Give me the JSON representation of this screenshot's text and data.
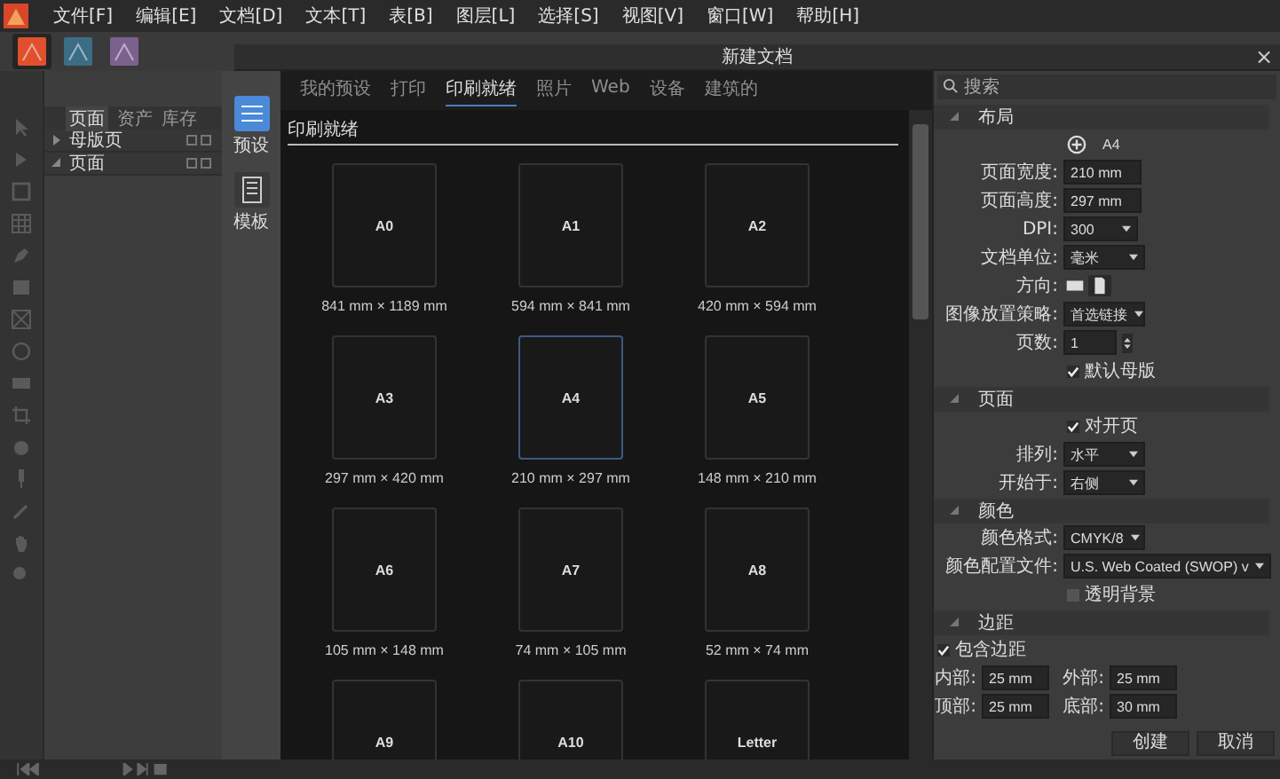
{
  "menu": [
    "文件[F]",
    "编辑[E]",
    "文档[D]",
    "文本[T]",
    "表[B]",
    "图层[L]",
    "选择[S]",
    "视图[V]",
    "窗口[W]",
    "帮助[H]"
  ],
  "apps": [
    {
      "kind": "publisher",
      "selected": true
    },
    {
      "kind": "designer",
      "selected": false
    },
    {
      "kind": "photo",
      "selected": false
    }
  ],
  "pages_panel": {
    "tabs": [
      {
        "label": "页面",
        "selected": true
      },
      {
        "label": "资产",
        "selected": false
      },
      {
        "label": "库存",
        "selected": false
      }
    ],
    "rows": [
      {
        "label": "母版页",
        "expanded": false
      },
      {
        "label": "页面",
        "expanded": true
      }
    ]
  },
  "dialog": {
    "title": "新建文档",
    "close": "×",
    "sidebar": [
      {
        "label": "预设",
        "kind": "presets",
        "selected": true
      },
      {
        "label": "模板",
        "kind": "templates",
        "selected": false
      }
    ],
    "tabs": [
      {
        "label": "我的预设",
        "selected": false
      },
      {
        "label": "打印",
        "selected": false
      },
      {
        "label": "印刷就绪",
        "selected": true
      },
      {
        "label": "照片",
        "selected": false
      },
      {
        "label": "Web",
        "selected": false
      },
      {
        "label": "设备",
        "selected": false
      },
      {
        "label": "建筑的",
        "selected": false
      }
    ],
    "section_title": "印刷就绪",
    "presets": [
      {
        "name": "A0",
        "size": "841 mm × 1189 mm",
        "selected": false
      },
      {
        "name": "A1",
        "size": "594 mm × 841 mm",
        "selected": false
      },
      {
        "name": "A2",
        "size": "420 mm × 594 mm",
        "selected": false
      },
      {
        "name": "A3",
        "size": "297 mm × 420 mm",
        "selected": false
      },
      {
        "name": "A4",
        "size": "210 mm × 297 mm",
        "selected": true
      },
      {
        "name": "A5",
        "size": "148 mm × 210 mm",
        "selected": false
      },
      {
        "name": "A6",
        "size": "105 mm × 148 mm",
        "selected": false
      },
      {
        "name": "A7",
        "size": "74 mm × 105 mm",
        "selected": false
      },
      {
        "name": "A8",
        "size": "52 mm × 74 mm",
        "selected": false
      },
      {
        "name": "A9",
        "selected": false
      },
      {
        "name": "A10",
        "selected": false
      },
      {
        "name": "Letter",
        "selected": false
      }
    ],
    "search": {
      "placeholder": "搜索"
    },
    "sections": [
      {
        "title": "布局",
        "expanded": true,
        "fields": [
          {
            "kind": "preset",
            "value": "A4"
          },
          {
            "kind": "text",
            "label": "页面宽度:",
            "value": "210 mm"
          },
          {
            "kind": "text",
            "label": "页面高度:",
            "value": "297 mm"
          },
          {
            "kind": "combo",
            "label": "DPI:",
            "value": "300"
          },
          {
            "kind": "select",
            "label": "文档单位:",
            "value": "毫米"
          },
          {
            "kind": "orientation",
            "label": "方向:",
            "portrait": true
          },
          {
            "kind": "select",
            "label": "图像放置策略:",
            "value": "首选链接"
          },
          {
            "kind": "spinner",
            "label": "页数:",
            "value": "1"
          },
          {
            "kind": "checkbox",
            "label": "默认母版",
            "checked": true
          }
        ]
      },
      {
        "title": "页面",
        "expanded": true,
        "fields": [
          {
            "kind": "checkbox",
            "label": "对开页",
            "checked": true
          },
          {
            "kind": "select",
            "label": "排列:",
            "value": "水平"
          },
          {
            "kind": "select",
            "label": "开始于:",
            "value": "右侧"
          }
        ]
      },
      {
        "title": "颜色",
        "expanded": true,
        "fields": [
          {
            "kind": "select",
            "label": "颜色格式:",
            "value": "CMYK/8"
          },
          {
            "kind": "wide-select",
            "label": "颜色配置文件:",
            "value": "U.S. Web Coated (SWOP) v"
          },
          {
            "kind": "checkbox",
            "label": "透明背景",
            "checked": false
          }
        ]
      },
      {
        "title": "边距",
        "expanded": true,
        "fields": [
          {
            "kind": "checkbox-left",
            "label": "包含边距",
            "checked": true
          },
          {
            "kind": "pair",
            "label": "内部:",
            "value": "25 mm",
            "label2": "外部:",
            "value2": "25 mm"
          },
          {
            "kind": "pair",
            "label": "顶部:",
            "value": "25 mm",
            "label2": "底部:",
            "value2": "30 mm"
          }
        ]
      }
    ],
    "buttons": [
      "创建",
      "取消"
    ]
  }
}
